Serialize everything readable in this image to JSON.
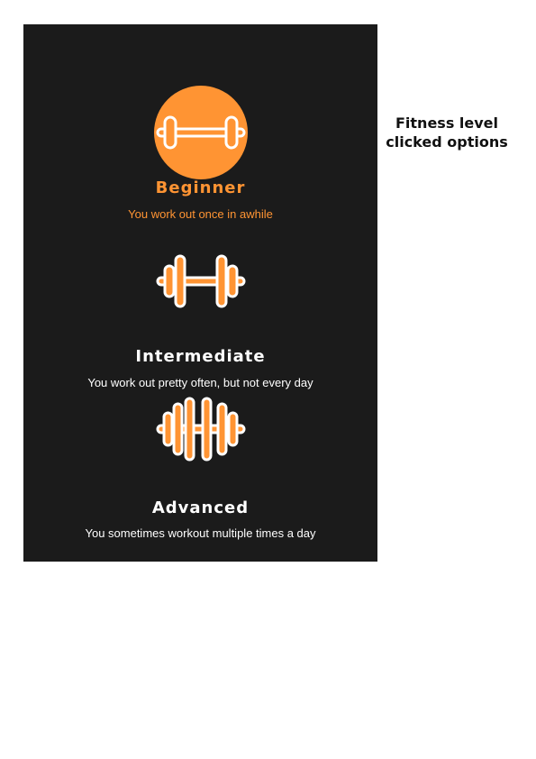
{
  "fitness_options": [
    {
      "title": "Beginner",
      "description": "You work out once in awhile",
      "icon": "dumbbell-light-icon",
      "selected": true
    },
    {
      "title": "Intermediate",
      "description": "You work out pretty often, but not every day",
      "icon": "dumbbell-medium-icon",
      "selected": false
    },
    {
      "title": "Advanced",
      "description": "You sometimes workout multiple times a day",
      "icon": "dumbbell-heavy-icon",
      "selected": false
    }
  ],
  "side_note": "Fitness level clicked options",
  "colors": {
    "accent": "#ff9433",
    "background": "#1b1b1b",
    "text": "#ffffff"
  }
}
